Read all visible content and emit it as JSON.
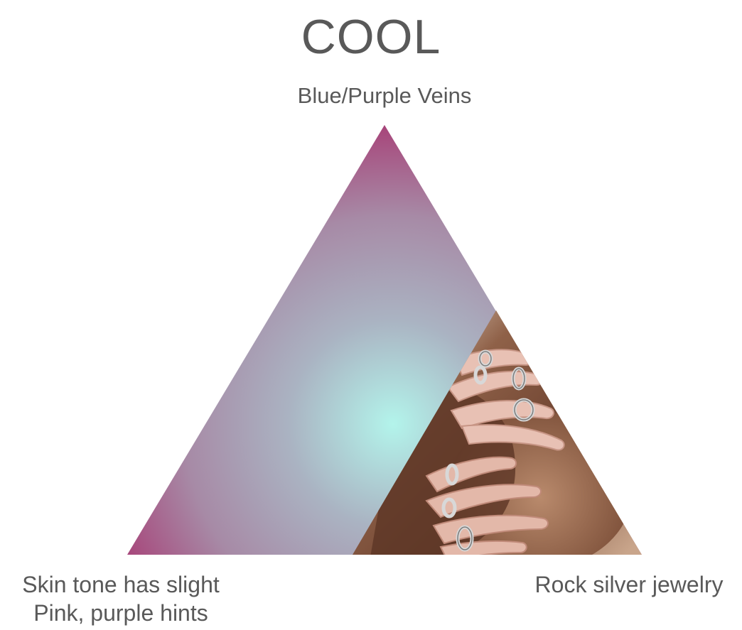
{
  "title": "COOL",
  "labels": {
    "top": "Blue/Purple Veins",
    "left_line1": "Skin tone has slight",
    "left_line2": "Pink, purple hints",
    "right": "Rock silver jewelry"
  },
  "colors": {
    "text": "#595959",
    "gradient_center": "#b3f2ea",
    "gradient_mid": "#a9aec0",
    "gradient_edge": "#a7457a",
    "skin": "#8a5a44"
  },
  "photo": {
    "subject": "hands-with-silver-rings"
  }
}
